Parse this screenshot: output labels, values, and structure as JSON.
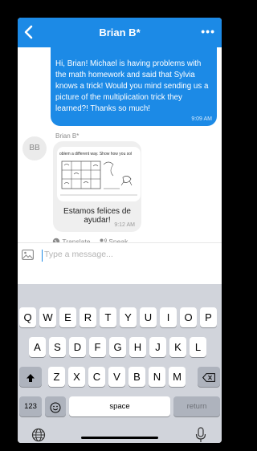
{
  "header": {
    "title": "Brian B*",
    "more_label": "•••"
  },
  "messages": {
    "outgoing": {
      "text": "Hi, Brian! Michael is having problems with the math homework and said that Sylvia knows a trick! Would you mind sending us a picture of the multiplication trick they learned?! Thanks so much!",
      "time": "9:09 AM"
    },
    "incoming": {
      "avatar_initials": "BB",
      "sender": "Brian B*",
      "image_text": "oblem a different way. Show how you sol",
      "caption": "Estamos felices de ayudar!",
      "time": "9:12 AM"
    }
  },
  "actions": {
    "translate": "Translate",
    "speak": "Speak"
  },
  "composer": {
    "placeholder": "Type a message..."
  },
  "keyboard": {
    "row1": [
      "Q",
      "W",
      "E",
      "R",
      "T",
      "Y",
      "U",
      "I",
      "O",
      "P"
    ],
    "row2": [
      "A",
      "S",
      "D",
      "F",
      "G",
      "H",
      "J",
      "K",
      "L"
    ],
    "row3": [
      "Z",
      "X",
      "C",
      "V",
      "B",
      "N",
      "M"
    ],
    "numbers": "123",
    "space": "space",
    "return": "return"
  },
  "colors": {
    "accent": "#1c8ae6",
    "keyboard_bg": "#d1d4db"
  }
}
